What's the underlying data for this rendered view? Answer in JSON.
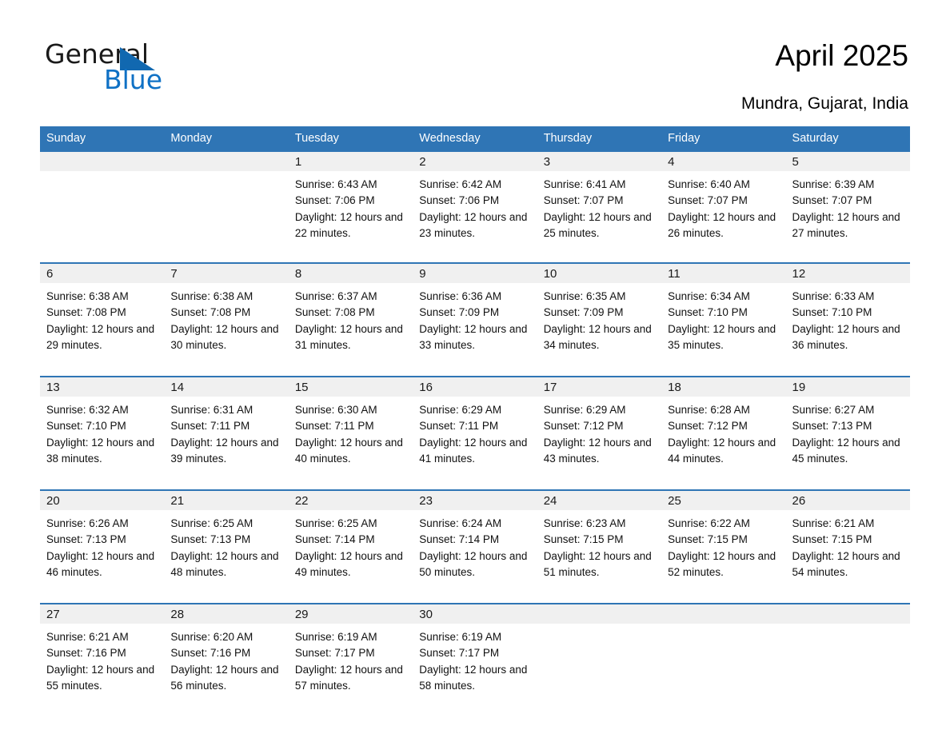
{
  "logo": {
    "word_one": "General",
    "word_two": "Blue",
    "triangle_color": "#1168b0",
    "blue_text_color": "#0f71c5"
  },
  "header": {
    "title": "April 2025",
    "subtitle": "Mundra, Gujarat, India"
  },
  "colors": {
    "header_blue": "#2f75b5",
    "row_rule_blue": "#2f75b5",
    "daynum_band": "#f0f0f0",
    "page_background": "#ffffff"
  },
  "calendar": {
    "weekday_headers": [
      "Sunday",
      "Monday",
      "Tuesday",
      "Wednesday",
      "Thursday",
      "Friday",
      "Saturday"
    ],
    "weeks": [
      [
        {
          "day": "",
          "lines": []
        },
        {
          "day": "",
          "lines": []
        },
        {
          "day": "1",
          "lines": [
            "Sunrise: 6:43 AM",
            "Sunset: 7:06 PM",
            "Daylight: 12 hours and 22 minutes."
          ]
        },
        {
          "day": "2",
          "lines": [
            "Sunrise: 6:42 AM",
            "Sunset: 7:06 PM",
            "Daylight: 12 hours and 23 minutes."
          ]
        },
        {
          "day": "3",
          "lines": [
            "Sunrise: 6:41 AM",
            "Sunset: 7:07 PM",
            "Daylight: 12 hours and 25 minutes."
          ]
        },
        {
          "day": "4",
          "lines": [
            "Sunrise: 6:40 AM",
            "Sunset: 7:07 PM",
            "Daylight: 12 hours and 26 minutes."
          ]
        },
        {
          "day": "5",
          "lines": [
            "Sunrise: 6:39 AM",
            "Sunset: 7:07 PM",
            "Daylight: 12 hours and 27 minutes."
          ]
        }
      ],
      [
        {
          "day": "6",
          "lines": [
            "Sunrise: 6:38 AM",
            "Sunset: 7:08 PM",
            "Daylight: 12 hours and 29 minutes."
          ]
        },
        {
          "day": "7",
          "lines": [
            "Sunrise: 6:38 AM",
            "Sunset: 7:08 PM",
            "Daylight: 12 hours and 30 minutes."
          ]
        },
        {
          "day": "8",
          "lines": [
            "Sunrise: 6:37 AM",
            "Sunset: 7:08 PM",
            "Daylight: 12 hours and 31 minutes."
          ]
        },
        {
          "day": "9",
          "lines": [
            "Sunrise: 6:36 AM",
            "Sunset: 7:09 PM",
            "Daylight: 12 hours and 33 minutes."
          ]
        },
        {
          "day": "10",
          "lines": [
            "Sunrise: 6:35 AM",
            "Sunset: 7:09 PM",
            "Daylight: 12 hours and 34 minutes."
          ]
        },
        {
          "day": "11",
          "lines": [
            "Sunrise: 6:34 AM",
            "Sunset: 7:10 PM",
            "Daylight: 12 hours and 35 minutes."
          ]
        },
        {
          "day": "12",
          "lines": [
            "Sunrise: 6:33 AM",
            "Sunset: 7:10 PM",
            "Daylight: 12 hours and 36 minutes."
          ]
        }
      ],
      [
        {
          "day": "13",
          "lines": [
            "Sunrise: 6:32 AM",
            "Sunset: 7:10 PM",
            "Daylight: 12 hours and 38 minutes."
          ]
        },
        {
          "day": "14",
          "lines": [
            "Sunrise: 6:31 AM",
            "Sunset: 7:11 PM",
            "Daylight: 12 hours and 39 minutes."
          ]
        },
        {
          "day": "15",
          "lines": [
            "Sunrise: 6:30 AM",
            "Sunset: 7:11 PM",
            "Daylight: 12 hours and 40 minutes."
          ]
        },
        {
          "day": "16",
          "lines": [
            "Sunrise: 6:29 AM",
            "Sunset: 7:11 PM",
            "Daylight: 12 hours and 41 minutes."
          ]
        },
        {
          "day": "17",
          "lines": [
            "Sunrise: 6:29 AM",
            "Sunset: 7:12 PM",
            "Daylight: 12 hours and 43 minutes."
          ]
        },
        {
          "day": "18",
          "lines": [
            "Sunrise: 6:28 AM",
            "Sunset: 7:12 PM",
            "Daylight: 12 hours and 44 minutes."
          ]
        },
        {
          "day": "19",
          "lines": [
            "Sunrise: 6:27 AM",
            "Sunset: 7:13 PM",
            "Daylight: 12 hours and 45 minutes."
          ]
        }
      ],
      [
        {
          "day": "20",
          "lines": [
            "Sunrise: 6:26 AM",
            "Sunset: 7:13 PM",
            "Daylight: 12 hours and 46 minutes."
          ]
        },
        {
          "day": "21",
          "lines": [
            "Sunrise: 6:25 AM",
            "Sunset: 7:13 PM",
            "Daylight: 12 hours and 48 minutes."
          ]
        },
        {
          "day": "22",
          "lines": [
            "Sunrise: 6:25 AM",
            "Sunset: 7:14 PM",
            "Daylight: 12 hours and 49 minutes."
          ]
        },
        {
          "day": "23",
          "lines": [
            "Sunrise: 6:24 AM",
            "Sunset: 7:14 PM",
            "Daylight: 12 hours and 50 minutes."
          ]
        },
        {
          "day": "24",
          "lines": [
            "Sunrise: 6:23 AM",
            "Sunset: 7:15 PM",
            "Daylight: 12 hours and 51 minutes."
          ]
        },
        {
          "day": "25",
          "lines": [
            "Sunrise: 6:22 AM",
            "Sunset: 7:15 PM",
            "Daylight: 12 hours and 52 minutes."
          ]
        },
        {
          "day": "26",
          "lines": [
            "Sunrise: 6:21 AM",
            "Sunset: 7:15 PM",
            "Daylight: 12 hours and 54 minutes."
          ]
        }
      ],
      [
        {
          "day": "27",
          "lines": [
            "Sunrise: 6:21 AM",
            "Sunset: 7:16 PM",
            "Daylight: 12 hours and 55 minutes."
          ]
        },
        {
          "day": "28",
          "lines": [
            "Sunrise: 6:20 AM",
            "Sunset: 7:16 PM",
            "Daylight: 12 hours and 56 minutes."
          ]
        },
        {
          "day": "29",
          "lines": [
            "Sunrise: 6:19 AM",
            "Sunset: 7:17 PM",
            "Daylight: 12 hours and 57 minutes."
          ]
        },
        {
          "day": "30",
          "lines": [
            "Sunrise: 6:19 AM",
            "Sunset: 7:17 PM",
            "Daylight: 12 hours and 58 minutes."
          ]
        },
        {
          "day": "",
          "lines": []
        },
        {
          "day": "",
          "lines": []
        },
        {
          "day": "",
          "lines": []
        }
      ]
    ]
  }
}
